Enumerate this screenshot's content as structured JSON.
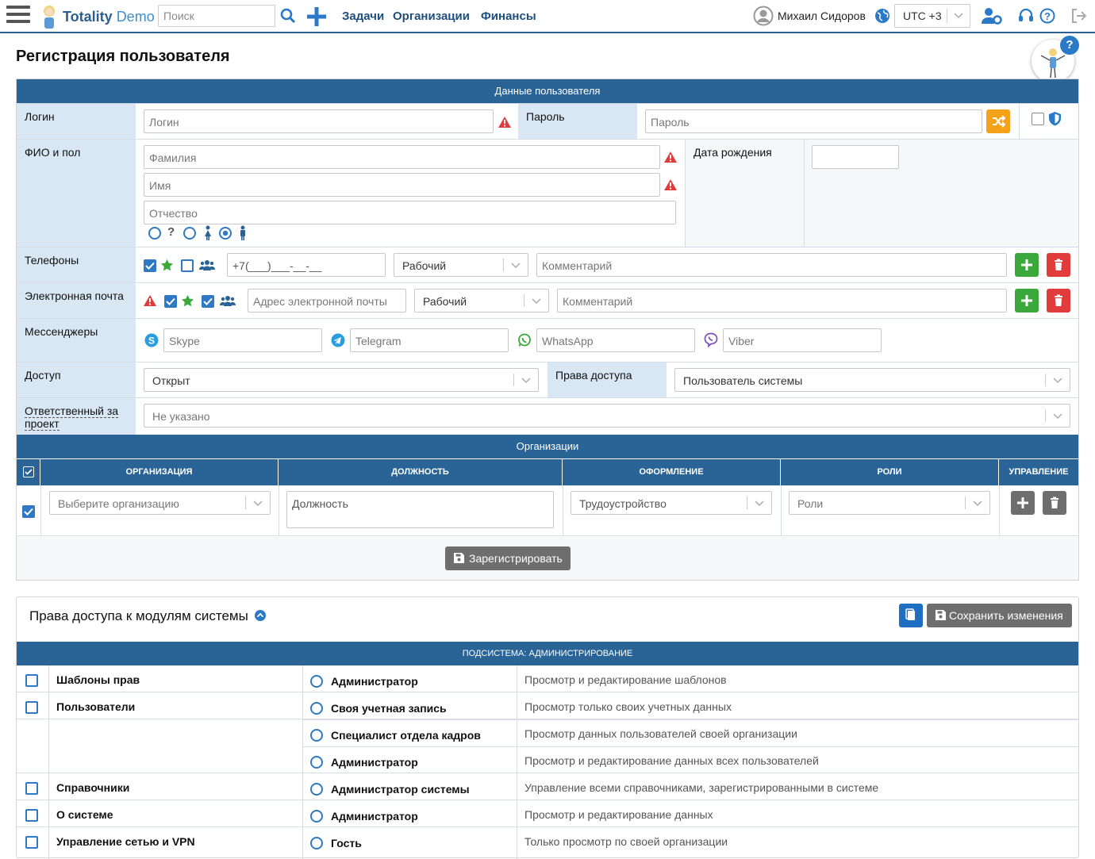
{
  "header": {
    "brand_main": "Totality",
    "brand_demo": "Demo",
    "search_placeholder": "Поиск",
    "nav": [
      "Задачи",
      "Организации",
      "Финансы"
    ],
    "user_name": "Михаил Сидоров",
    "timezone": "UTC +3"
  },
  "page": {
    "title": "Регистрация пользователя"
  },
  "form": {
    "section_title": "Данные пользователя",
    "login_label": "Логин",
    "login_placeholder": "Логин",
    "password_label": "Пароль",
    "password_placeholder": "Пароль",
    "fio_label": "ФИО и пол",
    "lastname_placeholder": "Фамилия",
    "firstname_placeholder": "Имя",
    "middlename_placeholder": "Отчество",
    "birthdate_label": "Дата рождения",
    "phones_label": "Телефоны",
    "phone_mask": "+7(___)___-__-__",
    "phone_type": "Рабочий",
    "phone_comment_placeholder": "Комментарий",
    "email_label": "Электронная почта",
    "email_placeholder": "Адрес электронной почты",
    "email_type": "Рабочий",
    "email_comment_placeholder": "Комментарий",
    "messengers_label": "Мессенджеры",
    "skype_placeholder": "Skype",
    "telegram_placeholder": "Telegram",
    "whatsapp_placeholder": "WhatsApp",
    "viber_placeholder": "Viber",
    "access_label": "Доступ",
    "access_value": "Открыт",
    "rights_label": "Права доступа",
    "rights_value": "Пользователь системы",
    "responsible_label": "Ответственный за проект",
    "responsible_value": "Не указано"
  },
  "orgs": {
    "section_title": "Организации",
    "columns": [
      "ОРГАНИЗАЦИЯ",
      "ДОЛЖНОСТЬ",
      "ОФОРМЛЕНИЕ",
      "РОЛИ",
      "УПРАВЛЕНИЕ"
    ],
    "org_placeholder": "Выберите организацию",
    "position_placeholder": "Должность",
    "employment_value": "Трудоустройство",
    "roles_placeholder": "Роли",
    "register_button": "Зарегистрировать"
  },
  "modules": {
    "title": "Права доступа к модулям системы",
    "save_button": "Сохранить изменения",
    "subsystem": "ПОДСИСТЕМА: АДМИНИСТРИРОВАНИЕ",
    "rows": [
      {
        "module": "Шаблоны прав",
        "role": "Администратор",
        "desc": "Просмотр и редактирование шаблонов"
      },
      {
        "module": "Пользователи",
        "role": "Своя учетная запись",
        "desc": "Просмотр только своих учетных данных"
      },
      {
        "module": "",
        "role": "Специалист отдела кадров",
        "desc": "Просмотр данных пользователей своей организации"
      },
      {
        "module": "",
        "role": "Администратор",
        "desc": "Просмотр и редактирование данных всех пользователей"
      },
      {
        "module": "Справочники",
        "role": "Администратор системы",
        "desc": "Управление всеми справочниками, зарегистрированными в системе"
      },
      {
        "module": "О системе",
        "role": "Администратор",
        "desc": "Просмотр и редактирование данных"
      },
      {
        "module": "Управление сетью и VPN",
        "role": "Гость",
        "desc": "Только просмотр по своей организации"
      }
    ]
  },
  "colors": {
    "primary": "#2a6496",
    "label_bg": "#d8e7f3",
    "green": "#3aa83a",
    "red": "#e23b3b",
    "orange": "#f5a21b"
  }
}
